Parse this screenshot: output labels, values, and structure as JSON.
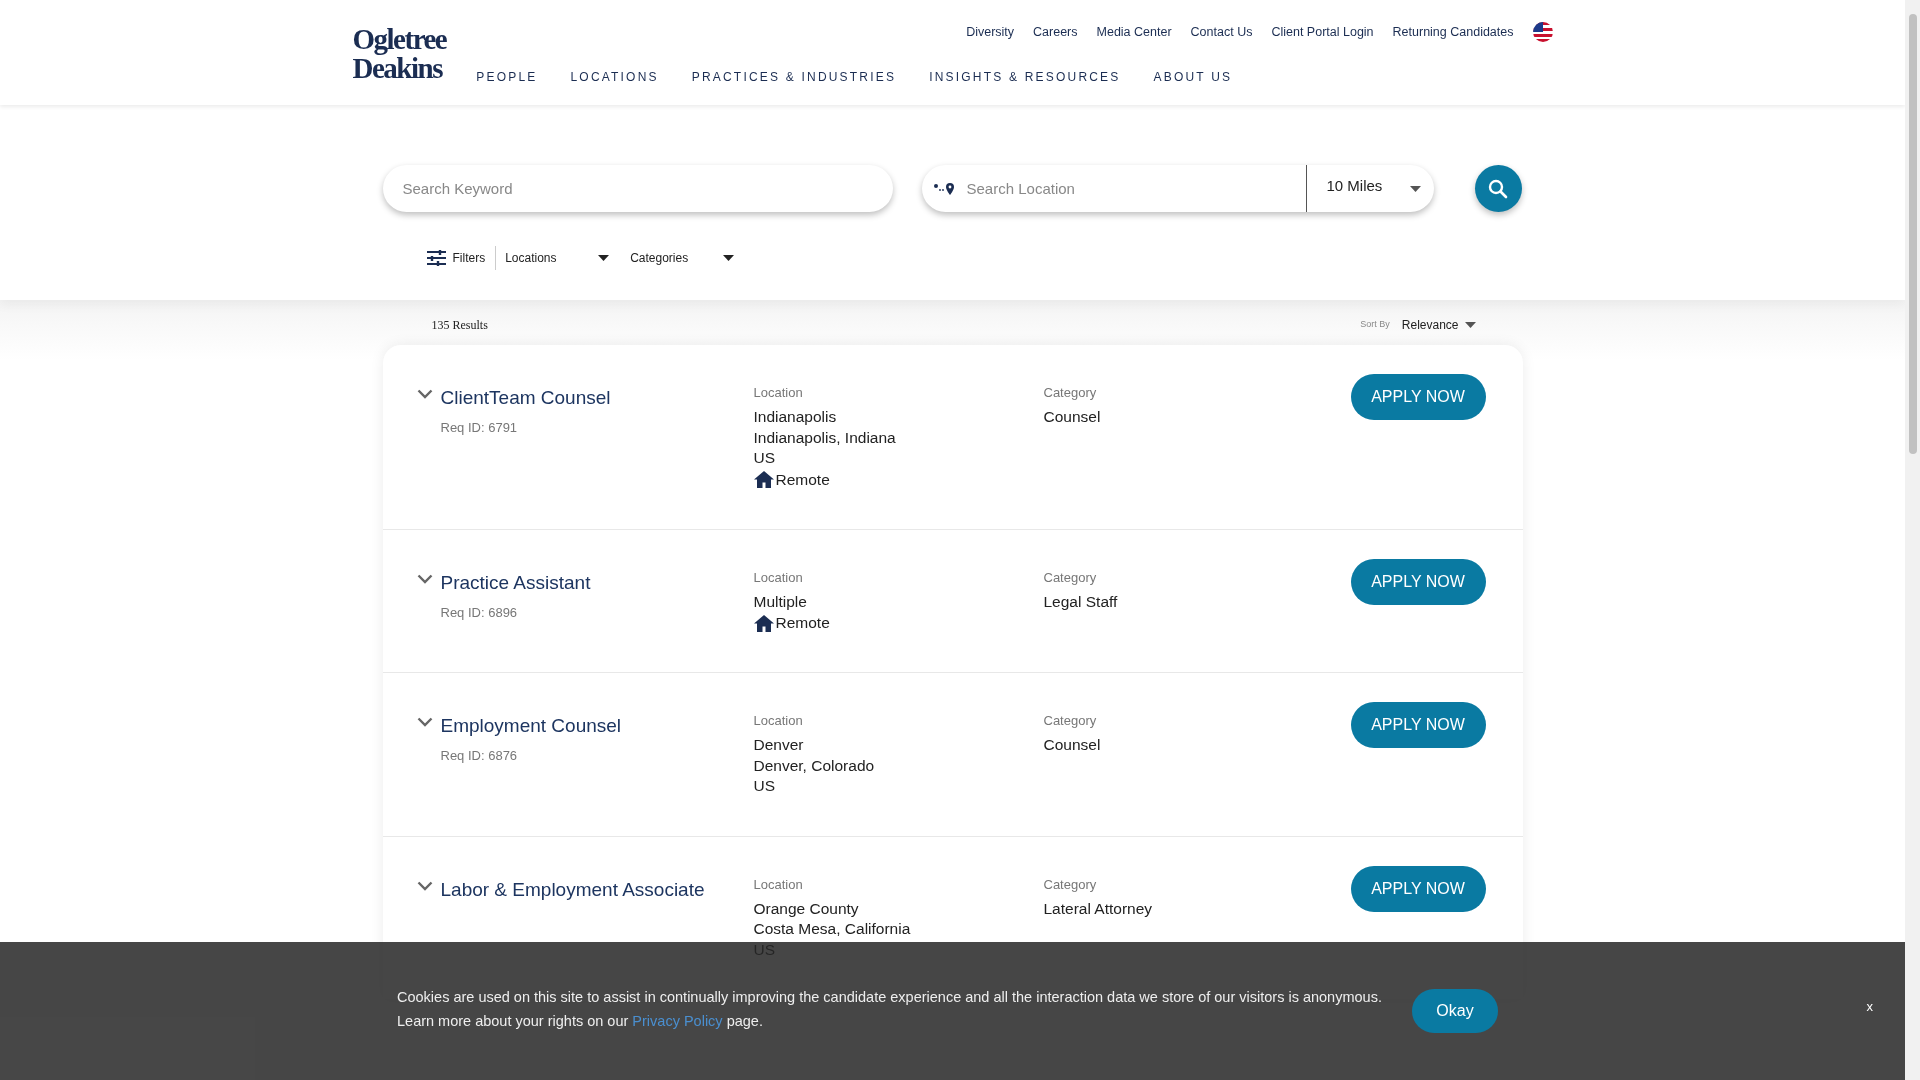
{
  "header": {
    "logo": [
      "Ogletree",
      "Deakins"
    ],
    "top_links": [
      "Diversity",
      "Careers",
      "Media Center",
      "Contact Us",
      "Client Portal Login",
      "Returning Candidates"
    ],
    "nav": [
      "PEOPLE",
      "LOCATIONS",
      "PRACTICES & INDUSTRIES",
      "INSIGHTS & RESOURCES",
      "ABOUT US"
    ]
  },
  "search": {
    "keyword": {
      "placeholder": "Search Keyword"
    },
    "location": {
      "placeholder": "Search Location"
    },
    "distance": "10 Miles"
  },
  "filters": {
    "label": "Filters",
    "dropdowns": [
      "Locations",
      "Categories"
    ]
  },
  "results": {
    "count": "135 Results",
    "sort_label": "Sort By",
    "sort_value": "Relevance"
  },
  "jobs": [
    {
      "title": "ClientTeam Counsel",
      "req_id": "Req ID: 6791",
      "location_label": "Location",
      "location": [
        "Indianapolis",
        "Indianapolis, Indiana",
        "US"
      ],
      "remote": "Remote",
      "category_label": "Category",
      "category": "Counsel",
      "button": "APPLY NOW"
    },
    {
      "title": "Practice Assistant",
      "req_id": "Req ID: 6896",
      "location_label": "Location",
      "location": [
        "Multiple"
      ],
      "remote": "Remote",
      "category_label": "Category",
      "category": "Legal Staff",
      "button": "APPLY NOW"
    },
    {
      "title": "Employment Counsel",
      "req_id": "Req ID: 6876",
      "location_label": "Location",
      "location": [
        "Denver",
        "Denver, Colorado",
        "US"
      ],
      "category_label": "Category",
      "category": "Counsel",
      "button": "APPLY NOW"
    },
    {
      "title": "Labor & Employment Associate",
      "location_label": "Location",
      "location": [
        "Orange County",
        "Costa Mesa, California",
        "US"
      ],
      "category_label": "Category",
      "category": "Lateral Attorney",
      "button": "APPLY NOW"
    }
  ],
  "cookie_banner": {
    "text": "Cookies are used on this site to assist in continually improving the candidate experience and all the interaction data we store of our visitors is anonymous.",
    "text_2": "Learn more about your rights on our",
    "link": "Privacy Policy",
    "text_3": "page.",
    "button": "Okay",
    "close": "x"
  }
}
